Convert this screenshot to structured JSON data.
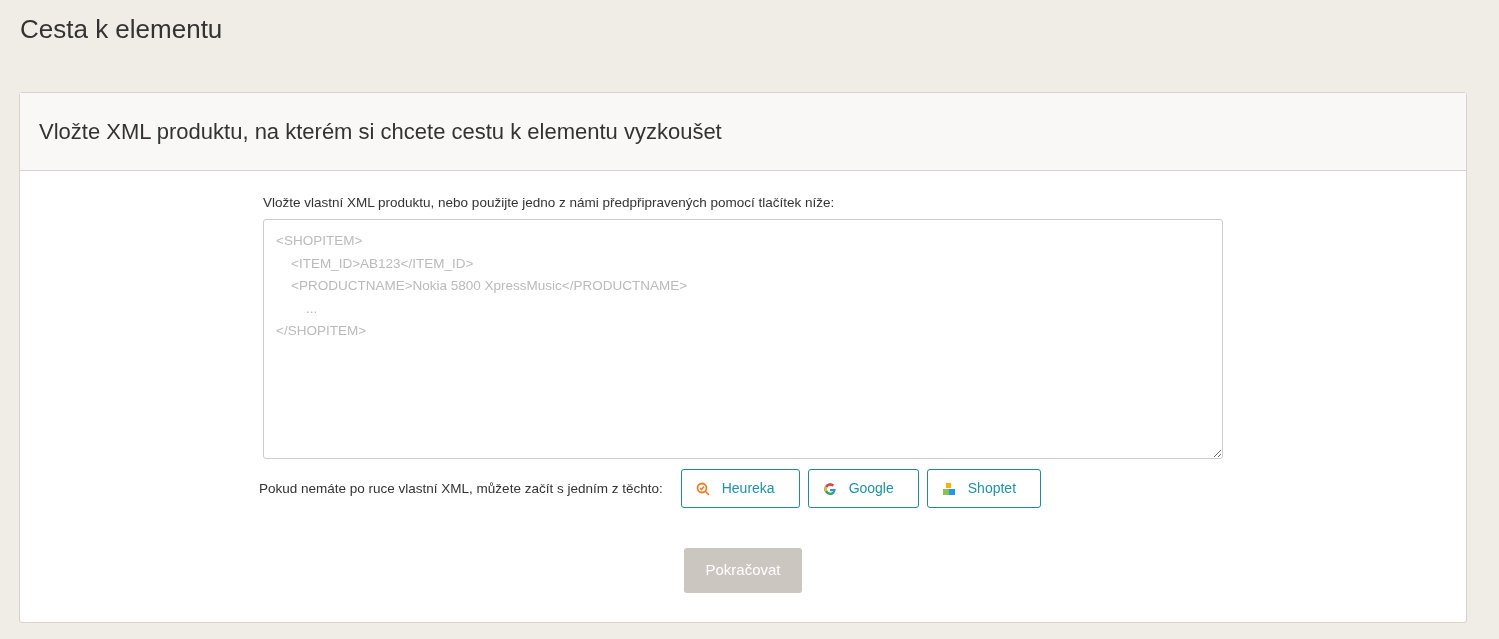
{
  "page_title": "Cesta k elementu",
  "card": {
    "header": "Vložte XML produktu, na kterém si chcete cestu k elementu vyzkoušet",
    "field_label": "Vložte vlastní XML produktu, nebo použijte jedno z námi předpřipravených pomocí tlačítek níže:",
    "xml_field": {
      "placeholder": "<SHOPITEM>\n    <ITEM_ID>AB123</ITEM_ID>\n    <PRODUCTNAME>Nokia 5800 XpressMusic</PRODUCTNAME>\n        ...\n</SHOPITEM>"
    },
    "samples_label": "Pokud nemáte po ruce vlastní XML, můžete začít s jedním z těchto:",
    "sample_buttons": [
      {
        "label": "Heureka",
        "kind": "heureka"
      },
      {
        "label": "Google",
        "kind": "google"
      },
      {
        "label": "Shoptet",
        "kind": "shoptet"
      }
    ],
    "continue_button": {
      "label": "Pokračovat",
      "disabled": true
    }
  }
}
